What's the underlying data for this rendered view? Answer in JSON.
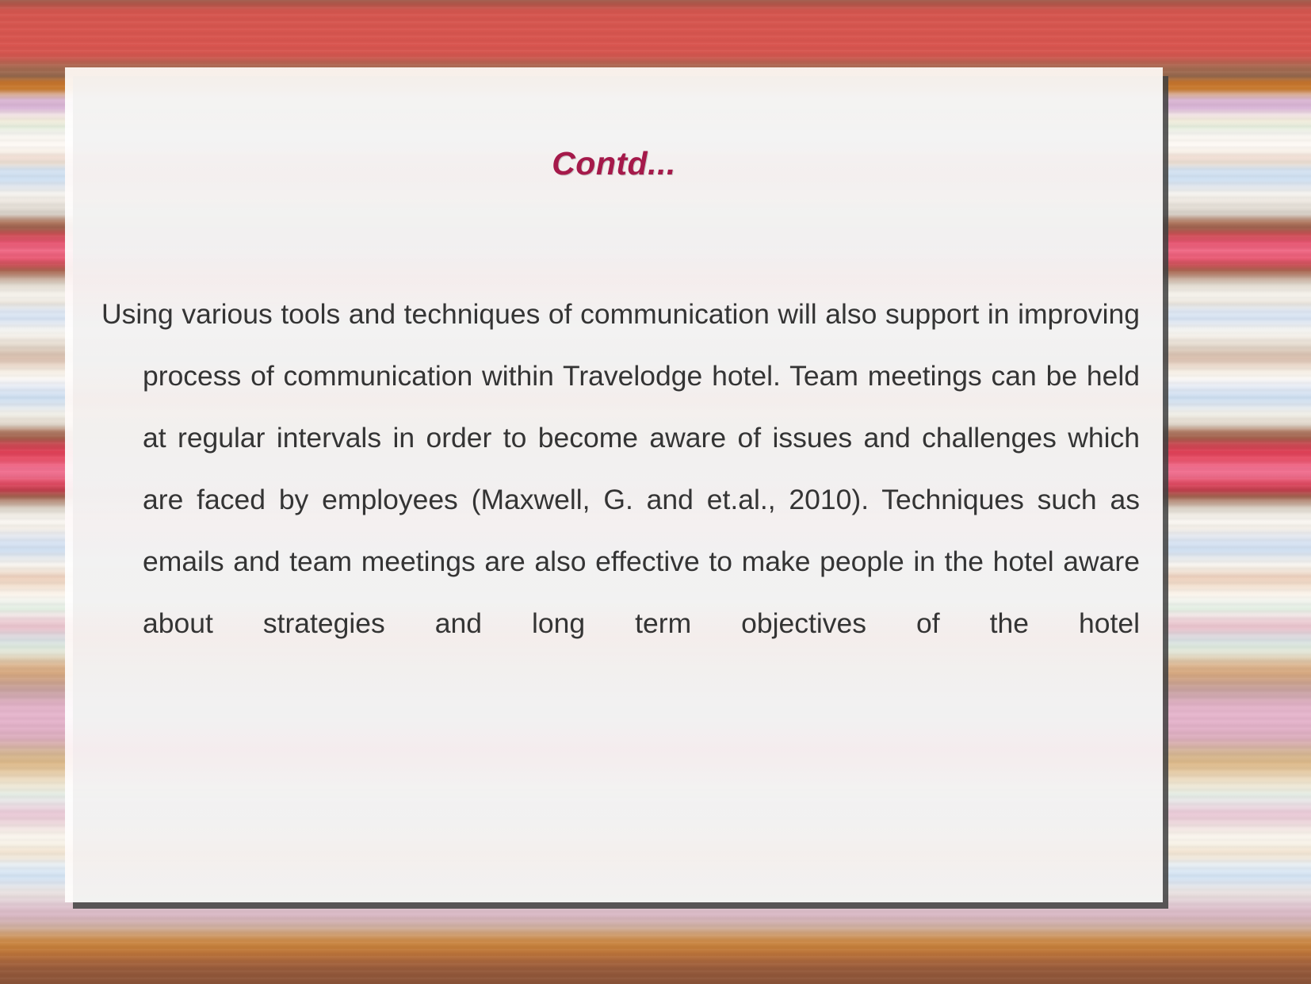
{
  "slide": {
    "title": "Contd...",
    "title_color": "#a5194a",
    "body_color": "#343434",
    "body_text": "Using various tools and techniques of communication will also support in improving process of communication within Travelodge hotel. Team meetings can be held at regular intervals in order to become aware of issues and challenges which are faced by employees (Maxwell, G. and et.al., 2010). Techniques such as emails and team meetings are also effective to make people in the hotel aware about strategies and long term objectives of the hotel",
    "body_lines": [
      "Using various tools and techniques of communication will also",
      "support in improving process of communication within",
      "Travelodge hotel. Team meetings can be held at regular intervals",
      "in order to become aware of issues and challenges which are",
      "faced by employees (Maxwell, G. and et.al., 2010). Techniques",
      "such as emails and team meetings are also effective to make",
      "people in the hotel aware about strategies and long term",
      "objectives of the hotel"
    ]
  }
}
